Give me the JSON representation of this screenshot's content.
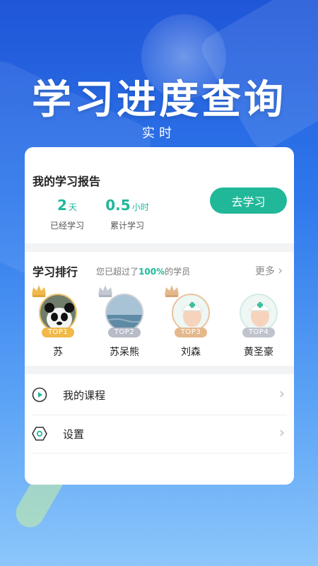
{
  "hero": {
    "title": "学习进度查询",
    "subtitle": "实时"
  },
  "report": {
    "title": "我的学习报告",
    "days_value": "2",
    "days_unit": "天",
    "days_label": "已经学习",
    "hours_value": "0.5",
    "hours_unit": "小时",
    "hours_label": "累计学习",
    "go_button": "去学习"
  },
  "ranking": {
    "title": "学习排行",
    "tip_prefix": "您已超过了",
    "tip_percent": "100%",
    "tip_suffix": "的学员",
    "more_label": "更多",
    "items": [
      {
        "badge": "TOP1",
        "name": "苏"
      },
      {
        "badge": "TOP2",
        "name": "苏呆熊"
      },
      {
        "badge": "TOP3",
        "name": "刘森"
      },
      {
        "badge": "TOP4",
        "name": "黄圣豪"
      }
    ]
  },
  "menu": {
    "courses_label": "我的课程",
    "settings_label": "设置"
  },
  "colors": {
    "accent": "#21b899",
    "gold": "#f0b94a",
    "background": "#2f78ec"
  }
}
